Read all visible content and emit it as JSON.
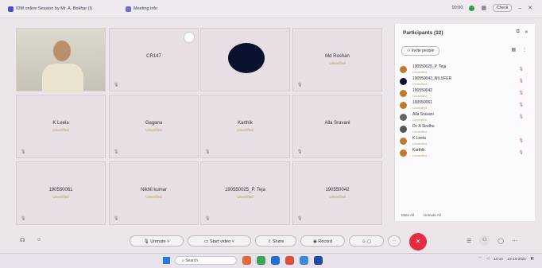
{
  "titlebar": {
    "tab1": "IDM online Session by Mr. A. Bokhar (I)",
    "tab2": "Meeting info",
    "time": "00:00",
    "pill": "Check",
    "min": "–",
    "close": "✕"
  },
  "grid": {
    "tiles": [
      {
        "name": "",
        "status": "",
        "kind": "camera"
      },
      {
        "name": "CR147",
        "status": "",
        "kind": "text"
      },
      {
        "name": "",
        "status": "",
        "kind": "avatar"
      },
      {
        "name": "Md Roshan",
        "status": "Unverified",
        "kind": "text"
      },
      {
        "name": "K Leela",
        "status": "Unverified",
        "kind": "text"
      },
      {
        "name": "Gagana",
        "status": "Unverified",
        "kind": "text"
      },
      {
        "name": "Karthik",
        "status": "Unverified",
        "kind": "text"
      },
      {
        "name": "Alla Sravani",
        "status": "",
        "kind": "text"
      },
      {
        "name": "190550061",
        "status": "Unverified",
        "kind": "text"
      },
      {
        "name": "Nikhil kumar",
        "status": "Unverified",
        "kind": "text"
      },
      {
        "name": "190550025_P. Teja",
        "status": "Unverified",
        "kind": "text"
      },
      {
        "name": "190550042",
        "status": "Unverified",
        "kind": "text"
      }
    ]
  },
  "panel": {
    "title": "Participants (32)",
    "invite": "Invite people",
    "participants": [
      {
        "name": "190550025_P. Teja",
        "sub": "Unverified",
        "color": "#c07a2c"
      },
      {
        "name": "190550042_NILUFER",
        "sub": "Unverified",
        "color": "#0b1230"
      },
      {
        "name": "190550042",
        "sub": "Unverified",
        "color": "#c07a2c"
      },
      {
        "name": "190550061",
        "sub": "Unverified",
        "color": "#c07a2c"
      },
      {
        "name": "Alla Sravani",
        "sub": "Unverified",
        "color": "#666666"
      },
      {
        "name": "Dr. A Sindhu",
        "sub": "Unverified",
        "color": "#555555"
      },
      {
        "name": "K Leela",
        "sub": "Unverified",
        "color": "#c07a2c"
      },
      {
        "name": "Karthik",
        "sub": "Unverified",
        "color": "#c07a2c"
      }
    ],
    "foot1": "Mute All",
    "foot2": "Unmute All"
  },
  "toolbar": {
    "unmute": "Unmute",
    "start_video": "Start video",
    "share": "Share",
    "record": "Record",
    "end": "✕"
  },
  "taskbar": {
    "search": "Search",
    "time": "10:10",
    "date": "23-10-2024"
  }
}
